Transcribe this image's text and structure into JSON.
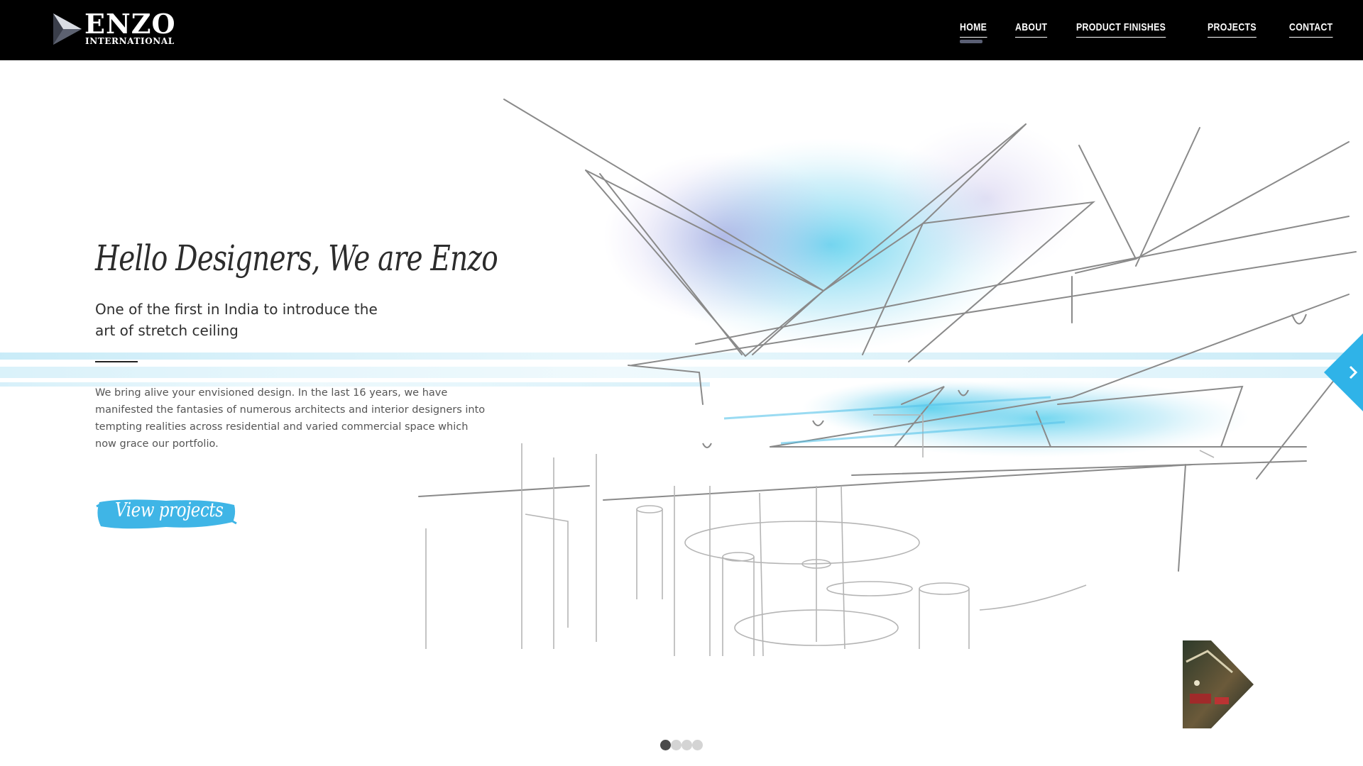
{
  "brand": {
    "name": "ENZO",
    "sub": "INTERNATIONAL"
  },
  "nav": {
    "items": [
      {
        "label": "HOME",
        "active": true
      },
      {
        "label": "ABOUT",
        "active": false
      },
      {
        "label": "PRODUCT FINISHES",
        "active": false
      },
      {
        "label": "PROJECTS",
        "active": false
      },
      {
        "label": "CONTACT",
        "active": false
      }
    ]
  },
  "hero": {
    "headline": "Hello Designers, We are Enzo",
    "subhead": "One of the first in India to introduce the art of stretch ceiling",
    "body": "We bring alive your envisioned design. In the last 16 years, we have manifested the fantasies of numerous architects and interior designers into tempting realities across residential and varied commercial space which now grace our portfolio.",
    "cta_label": "View projects"
  },
  "slider": {
    "next_icon": "chevron-right-icon",
    "slide_count": 4,
    "current_slide": 1
  },
  "colors": {
    "header_bg": "#000000",
    "accent": "#3fb5e6",
    "nav_active_indicator": "#5a5f74",
    "dot_active": "#4a4a4a",
    "dot_inactive": "#d4d4d4"
  }
}
